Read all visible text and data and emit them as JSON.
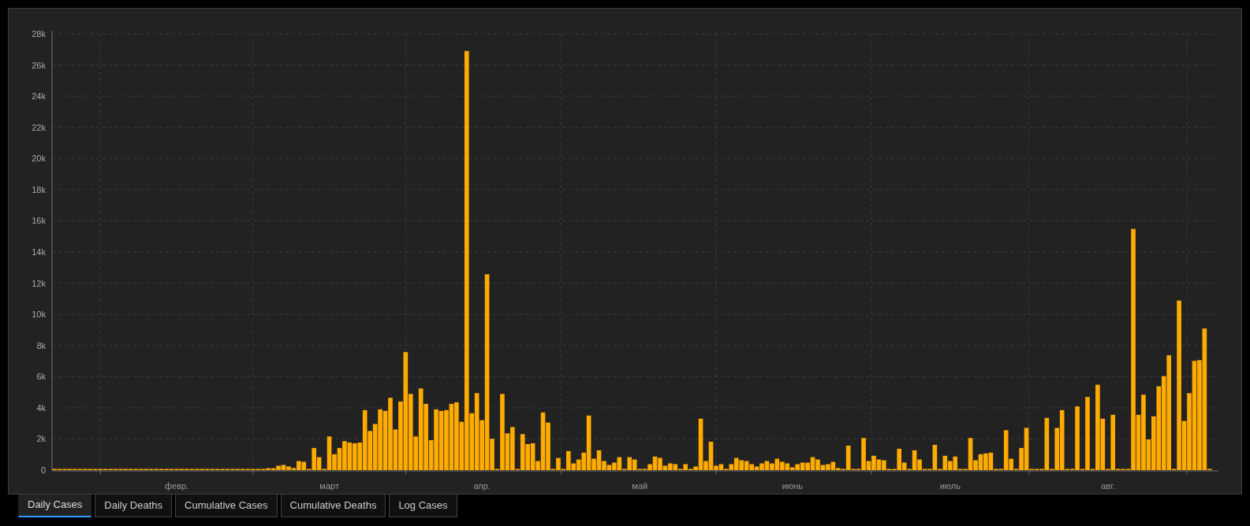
{
  "chart": {
    "chart_data": {
      "type": "bar",
      "ylim": [
        0,
        28000
      ],
      "grid": true,
      "yticks": [
        {
          "value": 0,
          "label": "0"
        },
        {
          "value": 2000,
          "label": "2k"
        },
        {
          "value": 4000,
          "label": "4k"
        },
        {
          "value": 6000,
          "label": "6k"
        },
        {
          "value": 8000,
          "label": "8k"
        },
        {
          "value": 10000,
          "label": "10k"
        },
        {
          "value": 12000,
          "label": "12k"
        },
        {
          "value": 14000,
          "label": "14k"
        },
        {
          "value": 16000,
          "label": "16k"
        },
        {
          "value": 18000,
          "label": "18k"
        },
        {
          "value": 20000,
          "label": "20k"
        },
        {
          "value": 22000,
          "label": "22k"
        },
        {
          "value": 24000,
          "label": "24k"
        },
        {
          "value": 26000,
          "label": "26k"
        },
        {
          "value": 28000,
          "label": "28k"
        }
      ],
      "categories": [
        null,
        null,
        null,
        null,
        null,
        null,
        null,
        null,
        null,
        null,
        null,
        null,
        null,
        null,
        null,
        null,
        null,
        null,
        null,
        null,
        null,
        null,
        null,
        null,
        "февр.",
        null,
        null,
        null,
        null,
        null,
        null,
        null,
        null,
        null,
        null,
        null,
        null,
        null,
        null,
        null,
        null,
        null,
        null,
        null,
        null,
        null,
        null,
        null,
        null,
        null,
        null,
        null,
        null,
        null,
        "март",
        null,
        null,
        null,
        null,
        null,
        null,
        null,
        null,
        null,
        null,
        null,
        null,
        null,
        null,
        null,
        null,
        null,
        null,
        null,
        null,
        null,
        null,
        null,
        null,
        null,
        null,
        null,
        null,
        null,
        "апр.",
        null,
        null,
        null,
        null,
        null,
        null,
        null,
        null,
        null,
        null,
        null,
        null,
        null,
        null,
        null,
        null,
        null,
        null,
        null,
        null,
        null,
        null,
        null,
        null,
        null,
        null,
        null,
        null,
        null,
        null,
        "май",
        null,
        null,
        null,
        null,
        null,
        null,
        null,
        null,
        null,
        null,
        null,
        null,
        null,
        null,
        null,
        null,
        null,
        null,
        null,
        null,
        null,
        null,
        null,
        null,
        null,
        null,
        null,
        null,
        null,
        "июнь",
        null,
        null,
        null,
        null,
        null,
        null,
        null,
        null,
        null,
        null,
        null,
        null,
        null,
        null,
        null,
        null,
        null,
        null,
        null,
        null,
        null,
        null,
        null,
        null,
        null,
        null,
        null,
        null,
        null,
        null,
        "июль",
        null,
        null,
        null,
        null,
        null,
        null,
        null,
        null,
        null,
        null,
        null,
        null,
        null,
        null,
        null,
        null,
        null,
        null,
        null,
        null,
        null,
        null,
        null,
        null,
        null,
        null,
        null,
        null,
        null,
        null,
        "авг.",
        null,
        null,
        null,
        null,
        null,
        null,
        null,
        null,
        null,
        null,
        null,
        null,
        null,
        null,
        null,
        null,
        null,
        null,
        null,
        null
      ],
      "series": [
        {
          "color": "#ffab00",
          "values": [
            20,
            20,
            20,
            20,
            20,
            20,
            20,
            20,
            20,
            20,
            20,
            20,
            20,
            20,
            20,
            20,
            20,
            20,
            20,
            20,
            20,
            20,
            20,
            20,
            20,
            20,
            20,
            20,
            20,
            20,
            20,
            20,
            20,
            20,
            20,
            20,
            20,
            20,
            60,
            60,
            60,
            20,
            120,
            120,
            280,
            330,
            230,
            130,
            580,
            530,
            20,
            1420,
            830,
            80,
            2160,
            1020,
            1420,
            1860,
            1770,
            1720,
            1770,
            3850,
            2510,
            2960,
            3900,
            3800,
            4640,
            2610,
            4400,
            7570,
            4890,
            2160,
            5240,
            4250,
            1920,
            3900,
            3800,
            3850,
            4250,
            4350,
            3100,
            26900,
            3650,
            4940,
            3200,
            12570,
            2010,
            30,
            4890,
            2360,
            2760,
            0,
            2310,
            1670,
            1720,
            580,
            3700,
            3050,
            0,
            780,
            20,
            1220,
            430,
            680,
            1120,
            3500,
            730,
            1270,
            580,
            330,
            480,
            830,
            0,
            830,
            680,
            20,
            80,
            380,
            870,
            780,
            280,
            430,
            380,
            20,
            380,
            0,
            230,
            3300,
            580,
            1820,
            280,
            380,
            0,
            380,
            780,
            630,
            580,
            380,
            230,
            430,
            580,
            430,
            730,
            530,
            430,
            180,
            380,
            480,
            480,
            830,
            680,
            330,
            380,
            530,
            130,
            0,
            1570,
            0,
            0,
            2060,
            580,
            920,
            680,
            630,
            0,
            0,
            1370,
            480,
            0,
            1270,
            680,
            0,
            0,
            1620,
            0,
            920,
            580,
            870,
            0,
            0,
            2060,
            630,
            1020,
            1070,
            1120,
            0,
            0,
            2560,
            730,
            0,
            1420,
            2710,
            0,
            0,
            0,
            3350,
            0,
            2710,
            3850,
            0,
            80,
            4090,
            0,
            4690,
            0,
            5480,
            3300,
            0,
            3550,
            0,
            0,
            0,
            15480,
            3550,
            4840,
            1970,
            3450,
            5380,
            6030,
            7370,
            0,
            10880,
            3150,
            4940,
            7010,
            7060,
            9090,
            0
          ]
        }
      ]
    }
  },
  "tabs": [
    {
      "label": "Daily Cases",
      "selected": true
    },
    {
      "label": "Daily Deaths",
      "selected": false
    },
    {
      "label": "Cumulative Cases",
      "selected": false
    },
    {
      "label": "Cumulative Deaths",
      "selected": false
    },
    {
      "label": "Log Cases",
      "selected": false
    }
  ]
}
